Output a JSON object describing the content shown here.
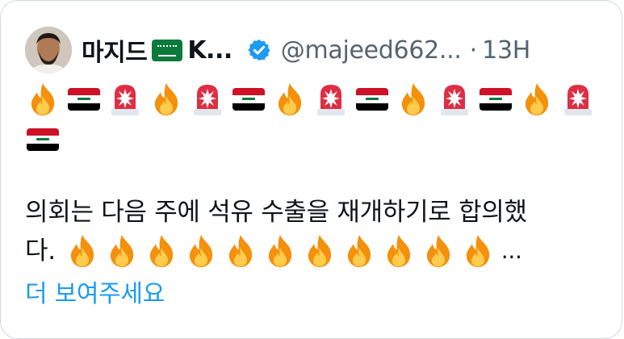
{
  "tweet": {
    "display_name": "마지드",
    "name_suffix": "K...",
    "flag_emoji": "saudi-arabia-flag",
    "handle": "@majeed662...",
    "separator": "·",
    "time": "13H",
    "emoji_row1": [
      "fire",
      "iraq-flag",
      "police-light",
      "fire",
      "police-light",
      "iraq-flag",
      "fire",
      "police-light",
      "iraq-flag",
      "fire",
      "police-light",
      "iraq-flag",
      "fire",
      "police-light"
    ],
    "emoji_row2": [
      "iraq-flag"
    ],
    "text_line1": "의회는 다음 주에 석유 수출을 재개하기로 합의했",
    "text_line2_start": "다.",
    "text_line2_fires": 11,
    "text_ellipsis": "...",
    "show_more": "더 보여주세요"
  },
  "colors": {
    "link": "#1d9bf0",
    "secondary": "#536471",
    "verified": "#1d9bf0",
    "border": "#cfd9de"
  }
}
